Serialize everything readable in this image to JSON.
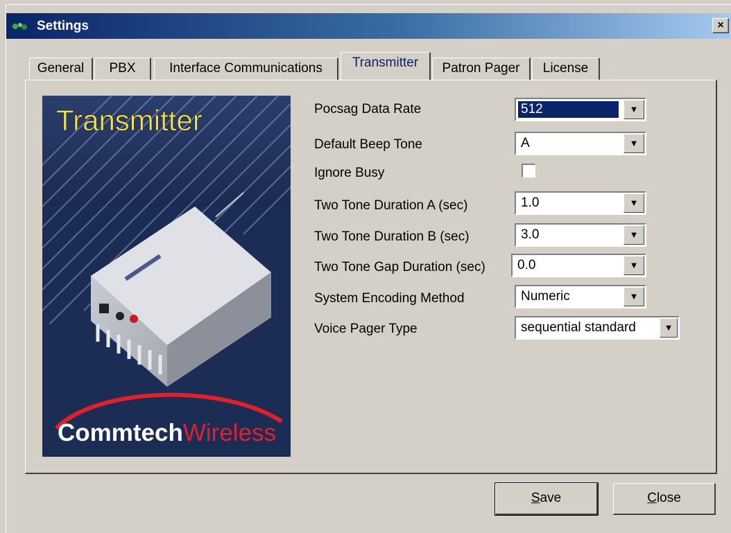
{
  "window": {
    "title": "Settings",
    "close_glyph": "×"
  },
  "tabs": [
    {
      "label": "General"
    },
    {
      "label": "PBX"
    },
    {
      "label": "Interface Communications"
    },
    {
      "label": "Transmitter",
      "active": true
    },
    {
      "label": "Patron Pager"
    },
    {
      "label": "License"
    }
  ],
  "hero": {
    "title": "Transmitter",
    "brand_part1": "Commtech",
    "brand_part2": "Wireless"
  },
  "fields": {
    "pocsag": {
      "label": "Pocsag Data Rate",
      "value": "512"
    },
    "beep": {
      "label": "Default Beep Tone",
      "value": "A"
    },
    "busy": {
      "label": "Ignore Busy",
      "checked": false
    },
    "dur_a": {
      "label": "Two Tone Duration A (sec)",
      "value": "1.0"
    },
    "dur_b": {
      "label": "Two Tone Duration B (sec)",
      "value": "3.0"
    },
    "gap": {
      "label": "Two Tone Gap Duration (sec)",
      "value": "0.0"
    },
    "encoding": {
      "label": "System Encoding Method",
      "value": "Numeric"
    },
    "voice": {
      "label": "Voice Pager Type",
      "value": "sequential standard"
    }
  },
  "buttons": {
    "save_mnemonic": "S",
    "save_rest": "ave",
    "close_mnemonic": "C",
    "close_rest": "lose"
  },
  "colors": {
    "titlebar_start": "#0a246a",
    "titlebar_end": "#a6caf0",
    "selection": "#0a246a",
    "hero_bg": "#1c2d55",
    "brand_red": "#e0202a"
  }
}
